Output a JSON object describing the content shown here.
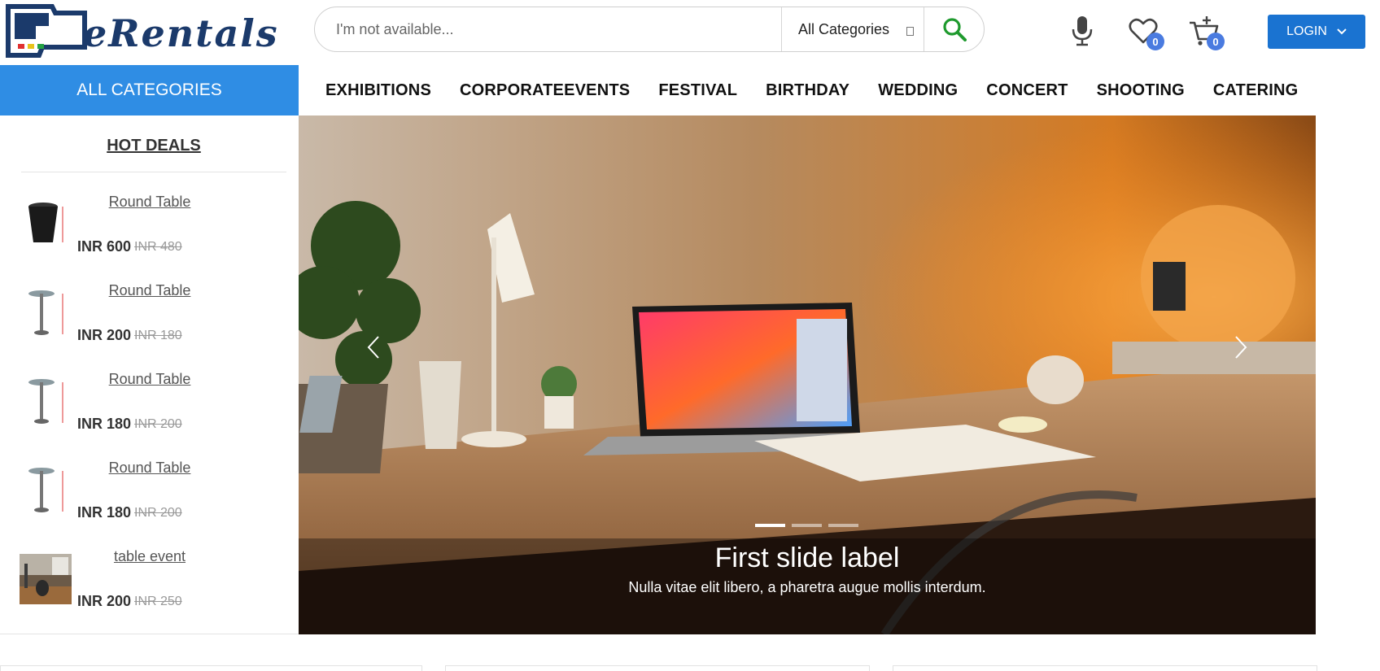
{
  "brand": {
    "logo_text": "eRentals"
  },
  "search": {
    "placeholder": "I'm not available...",
    "category_selected": "All Categories",
    "icon": "search-icon"
  },
  "header_actions": {
    "mic_icon": "microphone-icon",
    "wishlist_icon": "heart-icon",
    "wishlist_count": "0",
    "cart_icon": "cart-add-icon",
    "cart_count": "0",
    "login_label": "LOGIN"
  },
  "nav": {
    "all_categories": "ALL CATEGORIES",
    "items": [
      "EXHIBITIONS",
      "CORPORATEEVENTS",
      "FESTIVAL",
      "BIRTHDAY",
      "WEDDING",
      "CONCERT",
      "SHOOTING",
      "CATERING"
    ]
  },
  "hot_deals": {
    "title": "HOT DEALS",
    "items": [
      {
        "name": "Round Table",
        "price": "INR 600",
        "old_price": "INR 480"
      },
      {
        "name": "Round Table",
        "price": "INR 200",
        "old_price": "INR 180"
      },
      {
        "name": "Round Table",
        "price": "INR 180",
        "old_price": "INR 200"
      },
      {
        "name": "Round Table",
        "price": "INR 180",
        "old_price": "INR 200"
      },
      {
        "name": "table event",
        "price": "INR 200",
        "old_price": "INR 250"
      }
    ]
  },
  "carousel": {
    "title": "First slide label",
    "text": "Nulla vitae elit libero, a pharetra augue mollis interdum.",
    "slide_count": 3,
    "active_index": 0
  },
  "colors": {
    "brand_blue": "#2f8de4",
    "login_blue": "#1a73d1",
    "badge": "#4a7be0",
    "search_green": "#1f9a2e"
  }
}
